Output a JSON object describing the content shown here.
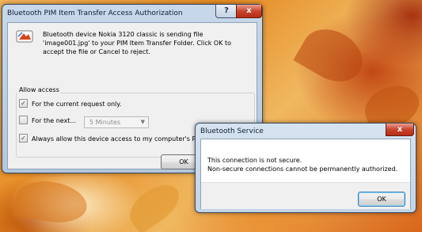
{
  "pim_dialog": {
    "title": "Bluetooth PIM Item Transfer Access Authorization",
    "help_label": "?",
    "close_label": "x",
    "message": "Bluetooth device Nokia 3120 classic is sending file 'image001.jpg' to your PIM Item Transfer Folder.  Click OK to accept the file or Cancel to reject.",
    "group_title": "Allow access",
    "options": [
      {
        "label": "For the current request only.",
        "checked": true
      },
      {
        "label": "For the next...",
        "checked": false
      },
      {
        "label": "Always allow this device access to my computer's PIM Item Tr",
        "checked": true
      }
    ],
    "duration_select": {
      "value": "5 Minutes"
    },
    "ok_label": "OK"
  },
  "service_dialog": {
    "title": "Bluetooth Service",
    "close_label": "x",
    "line1": "This connection is not secure.",
    "line2": "Non-secure connections cannot be permanently authorized.",
    "ok_label": "OK"
  },
  "colors": {
    "close_button": "#c9442d",
    "title_bar": "#b3c7dd",
    "check_mark": "#2a3d67"
  }
}
